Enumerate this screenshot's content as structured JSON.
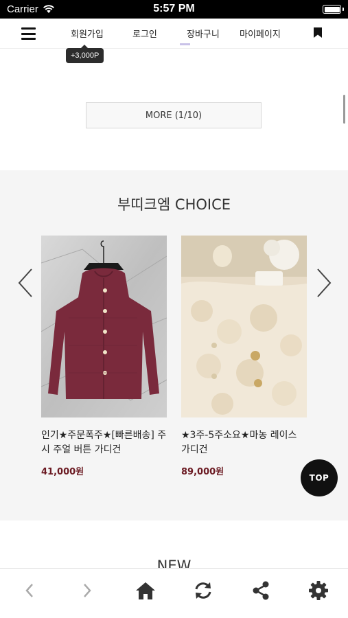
{
  "status_bar": {
    "carrier": "Carrier",
    "time": "5:57 PM"
  },
  "top_nav": {
    "join": "회원가입",
    "login": "로그인",
    "cart": "장바구니",
    "mypage": "마이페이지",
    "points_badge": "+3,000P"
  },
  "more_button": "MORE (1/10)",
  "choice": {
    "title": "부띠크엠 CHOICE",
    "products": [
      {
        "name": "인기★주문폭주★[빠른배송] 주시 주얼 버튼 가디건",
        "price": "41,000원"
      },
      {
        "name": "★3주-5주소요★마농 레이스 가디건",
        "price": "89,000원"
      }
    ]
  },
  "top_button": "TOP",
  "new_heading": "NEW",
  "icons": {
    "menu": "hamburger-icon",
    "bookmark": "bookmark-icon",
    "back": "chevron-left-icon",
    "forward": "chevron-right-icon",
    "home": "home-icon",
    "refresh": "refresh-icon",
    "share": "share-icon",
    "settings": "gear-icon"
  },
  "colors": {
    "price": "#6b1a22",
    "top_button": "#111111",
    "section_bg": "#f5f5f5"
  }
}
